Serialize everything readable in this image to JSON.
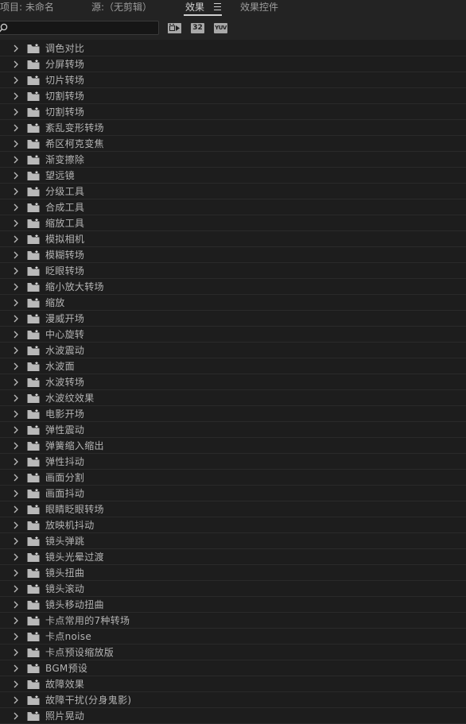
{
  "tabs": [
    {
      "label": "项目: 未命名",
      "active": false
    },
    {
      "label": "源:（无剪辑）",
      "active": false
    },
    {
      "label": "效果",
      "active": true
    },
    {
      "label": "效果控件",
      "active": false
    }
  ],
  "search": {
    "value": "",
    "placeholder": ""
  },
  "toolbar_buttons": [
    {
      "icon": "accelerated-effects-icon",
      "text": ""
    },
    {
      "icon": "32-bit-color-icon",
      "text": "32"
    },
    {
      "icon": "yuv-effects-icon",
      "text": "YUV"
    }
  ],
  "colors": {
    "background": "#1d1d1d",
    "panel": "#232323",
    "text": "#b4b4b4"
  },
  "effects_list": [
    "调色对比",
    "分屏转场",
    "切片转场",
    "切割转场",
    "切割转场",
    "紊乱变形转场",
    "希区柯克变焦",
    "渐变擦除",
    "望远镜",
    " 分级工具",
    " 合成工具",
    " 缩放工具",
    "模拟相机",
    "模糊转场",
    "眨眼转场",
    "缩小放大转场",
    "缩放",
    "漫威开场",
    "中心旋转",
    "水波震动",
    "水波面",
    "水波转场",
    "水波纹效果",
    "电影开场",
    "弹性震动",
    "弹簧缩入缩出",
    "弹性抖动",
    "画面分割",
    "画面抖动",
    "眼睛眨眼转场",
    "放映机抖动",
    "镜头弹跳",
    "镜头光晕过渡",
    "镜头扭曲",
    "镜头滚动",
    "镜头移动扭曲",
    "卡点常用的7种转场",
    "卡点noise",
    "卡点预设缩放版",
    "BGM预设",
    "故障效果",
    "故障干扰(分身鬼影)",
    "照片晃动"
  ]
}
